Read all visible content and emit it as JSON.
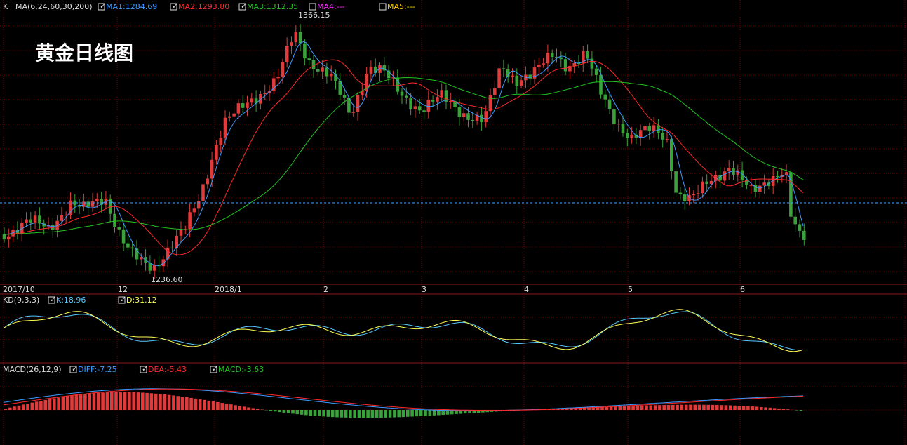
{
  "main_panel": {
    "label_k": "K",
    "label_ma": "MA(6,24,60,30,200)",
    "ma1": "MA1:1284.69",
    "ma2": "MA2:1293.80",
    "ma3": "MA3:1312.35",
    "ma4": "MA4:---",
    "ma5": "MA5:---",
    "title": "黄金日线图",
    "high_label": "1366.15",
    "low_label": "1236.60"
  },
  "x_axis": [
    "2017/10",
    "12",
    "2018/1",
    "2",
    "3",
    "4",
    "5",
    "6"
  ],
  "kd_panel": {
    "label": "KD(9,3,3)",
    "k": "K:18.96",
    "d": "D:31.12"
  },
  "macd_panel": {
    "label": "MACD(26,12,9)",
    "diff": "DIFF:-7.25",
    "dea": "DEA:-5.43",
    "macd": "MACD:-3.63"
  },
  "colors": {
    "up": "#e03a3a",
    "down": "#3aa23a",
    "ma1": "#3d9bff",
    "ma2": "#ff2a2a",
    "ma3": "#22c422",
    "ma4": "#ff2aff",
    "ma5": "#ffd400",
    "k": "#56c8ff",
    "d": "#ffff55",
    "grid": "#7a0000"
  },
  "chart_data": {
    "type": "candlestick",
    "y_range": [
      1236.6,
      1366.15
    ],
    "current_price": 1253.9,
    "annotations": {
      "high": 1366.15,
      "low": 1236.6
    },
    "moving_averages": {
      "MA1": 1284.69,
      "MA2": 1293.8,
      "MA3": 1312.35
    },
    "kd": {
      "K": 18.96,
      "D": 31.12
    },
    "macd": {
      "DIFF": -7.25,
      "DEA": -5.43,
      "MACD": -3.63
    },
    "x_labels": [
      "2017/10",
      "12",
      "2018/1",
      "2",
      "3",
      "4",
      "5",
      "6"
    ]
  }
}
